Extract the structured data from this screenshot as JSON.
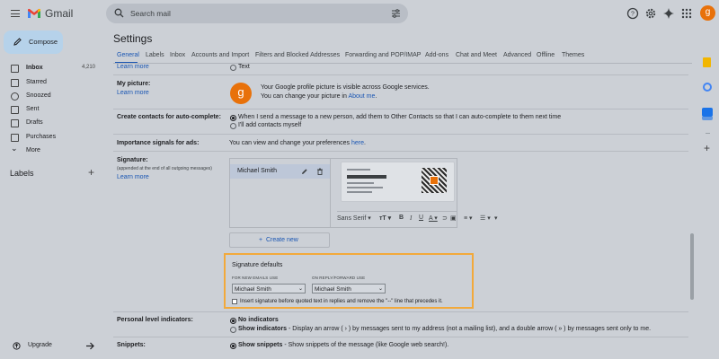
{
  "app": {
    "name": "Gmail"
  },
  "search": {
    "placeholder": "Search mail"
  },
  "user": {
    "initial": "g"
  },
  "compose": {
    "label": "Compose"
  },
  "nav": [
    {
      "label": "Inbox",
      "count": "4,210",
      "icon": "inbox-icon",
      "bold": true
    },
    {
      "label": "Starred",
      "count": "",
      "icon": "star-icon"
    },
    {
      "label": "Snoozed",
      "count": "",
      "icon": "clock-icon"
    },
    {
      "label": "Sent",
      "count": "",
      "icon": "send-icon"
    },
    {
      "label": "Drafts",
      "count": "",
      "icon": "draft-icon"
    },
    {
      "label": "Purchases",
      "count": "",
      "icon": "tag-icon"
    },
    {
      "label": "More",
      "count": "",
      "icon": "chevron-down-icon"
    }
  ],
  "labels": {
    "title": "Labels",
    "add": "+"
  },
  "upgrade": {
    "label": "Upgrade"
  },
  "settings": {
    "title": "Settings",
    "tabs": [
      "General",
      "Labels",
      "Inbox",
      "Accounts and Import",
      "Filters and Blocked Addresses",
      "Forwarding and POP/IMAP",
      "Add-ons",
      "Chat and Meet",
      "Advanced",
      "Offline",
      "Themes"
    ],
    "learn_more": "Learn more",
    "text_option": "Text",
    "my_picture": {
      "label": "My picture:",
      "line1": "Your Google profile picture is visible across Google services.",
      "line2_prefix": "You can change your picture in ",
      "line2_link": "About me",
      "line2_suffix": "."
    },
    "create_contacts": {
      "label": "Create contacts for auto-complete:",
      "opt1": "When I send a message to a new person, add them to Other Contacts so that I can auto-complete to them next time",
      "opt2": "I'll add contacts myself"
    },
    "importance": {
      "label": "Importance signals for ads:",
      "text": "You can view and change your preferences ",
      "link": "here",
      "suffix": "."
    },
    "signature": {
      "label": "Signature:",
      "sub": "(appended at the end of all outgoing messages)",
      "name": "Michael Smith",
      "font": "Sans Serif",
      "create_new": "Create new",
      "defaults_title": "Signature defaults",
      "new_emails_label": "FOR NEW EMAILS USE",
      "reply_label": "ON REPLY/FORWARD USE",
      "new_value": "Michael Smith",
      "reply_value": "Michael Smith",
      "insert_text": "Insert signature before quoted text in replies and remove the \"--\" line that precedes it."
    },
    "personal": {
      "label": "Personal level indicators:",
      "opt1": "No indicators",
      "opt2_bold": "Show indicators",
      "opt2_rest": " - Display an arrow ( › ) by messages sent to my address (not a mailing list), and a double arrow ( » ) by messages sent only to me."
    },
    "snippets": {
      "label": "Snippets:",
      "opt1_bold": "Show snippets",
      "opt1_rest": " - Show snippets of the message (like Google web search!)."
    }
  },
  "colors": {
    "accent": "#1a56b3",
    "highlight": "#f2a93b",
    "avatar": "#e8710a"
  }
}
